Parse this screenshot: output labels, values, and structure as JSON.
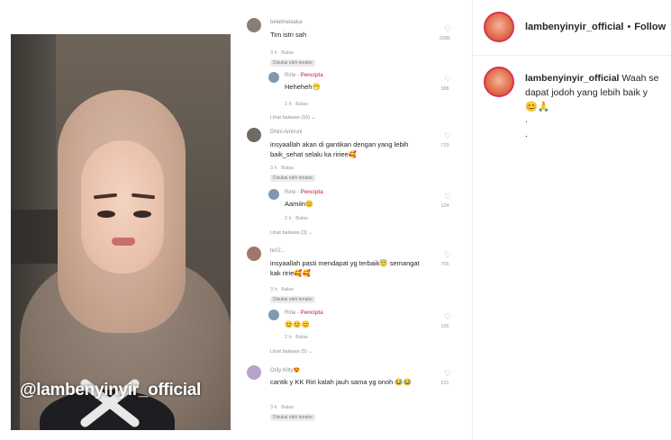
{
  "video": {
    "watermark": "@lambenyinyir_official"
  },
  "comments": [
    {
      "user": "belalmelaaka",
      "text": "Tim istri sah",
      "time": "3 h",
      "reply_label": "Balas",
      "likes": "2085",
      "badge": "Disukai oleh kreator",
      "replies": [
        {
          "user": "Ririe",
          "role": "Pencipta",
          "text": "Heheheh😁",
          "time": "2 h",
          "reply_label": "Balas",
          "likes": "388"
        }
      ],
      "more": "Lihat balasan (16)"
    },
    {
      "user": "Dhini Amiruni",
      "text": "insyaallah akan di gantikan dengan yang lebih baik_sehat selalu ka ririee🥰",
      "time": "3 h",
      "reply_label": "Balas",
      "likes": "723",
      "badge": "Disukai oleh kreator",
      "replies": [
        {
          "user": "Ririe",
          "role": "Pencipta",
          "text": "Aamiin😊",
          "time": "2 h",
          "reply_label": "Balas",
          "likes": "124"
        }
      ],
      "more": "Lihat balasan (3)"
    },
    {
      "user": "teri2...",
      "text": "insyaallah pasti mendapat yg terbaik😇 semangat kak ririe🥰🥰",
      "time": "3 h",
      "reply_label": "Balas",
      "likes": "765",
      "badge": "Disukai oleh kreator",
      "replies": [
        {
          "user": "Ririe",
          "role": "Pencipta",
          "text": "😊😊😊",
          "time": "2 h",
          "reply_label": "Balas",
          "likes": "106"
        }
      ],
      "more": "Lihat balasan (5)"
    },
    {
      "user": "Orily Kitty😍",
      "text": "cantik y KK Riri kalah jauh sama yg onoh 😂😂",
      "time": "3 h",
      "reply_label": "Balas",
      "likes": "231",
      "badge": "Disukai oleh kreator",
      "replies": [],
      "more": ""
    }
  ],
  "instagram": {
    "account": "lambenyinyir_official",
    "separator": "•",
    "follow_label": "Follow",
    "caption_user": "lambenyinyir_official",
    "caption_line1": "Waah se",
    "caption_line2": "dapat jodoh yang lebih baik y",
    "caption_emojis": "😊🙏",
    "dot1": ".",
    "dot2": "."
  },
  "colors": {
    "creator_accent": "#e0507a",
    "story_ring": "#d9344d"
  },
  "icons": {
    "like": "heart-outline-icon"
  }
}
